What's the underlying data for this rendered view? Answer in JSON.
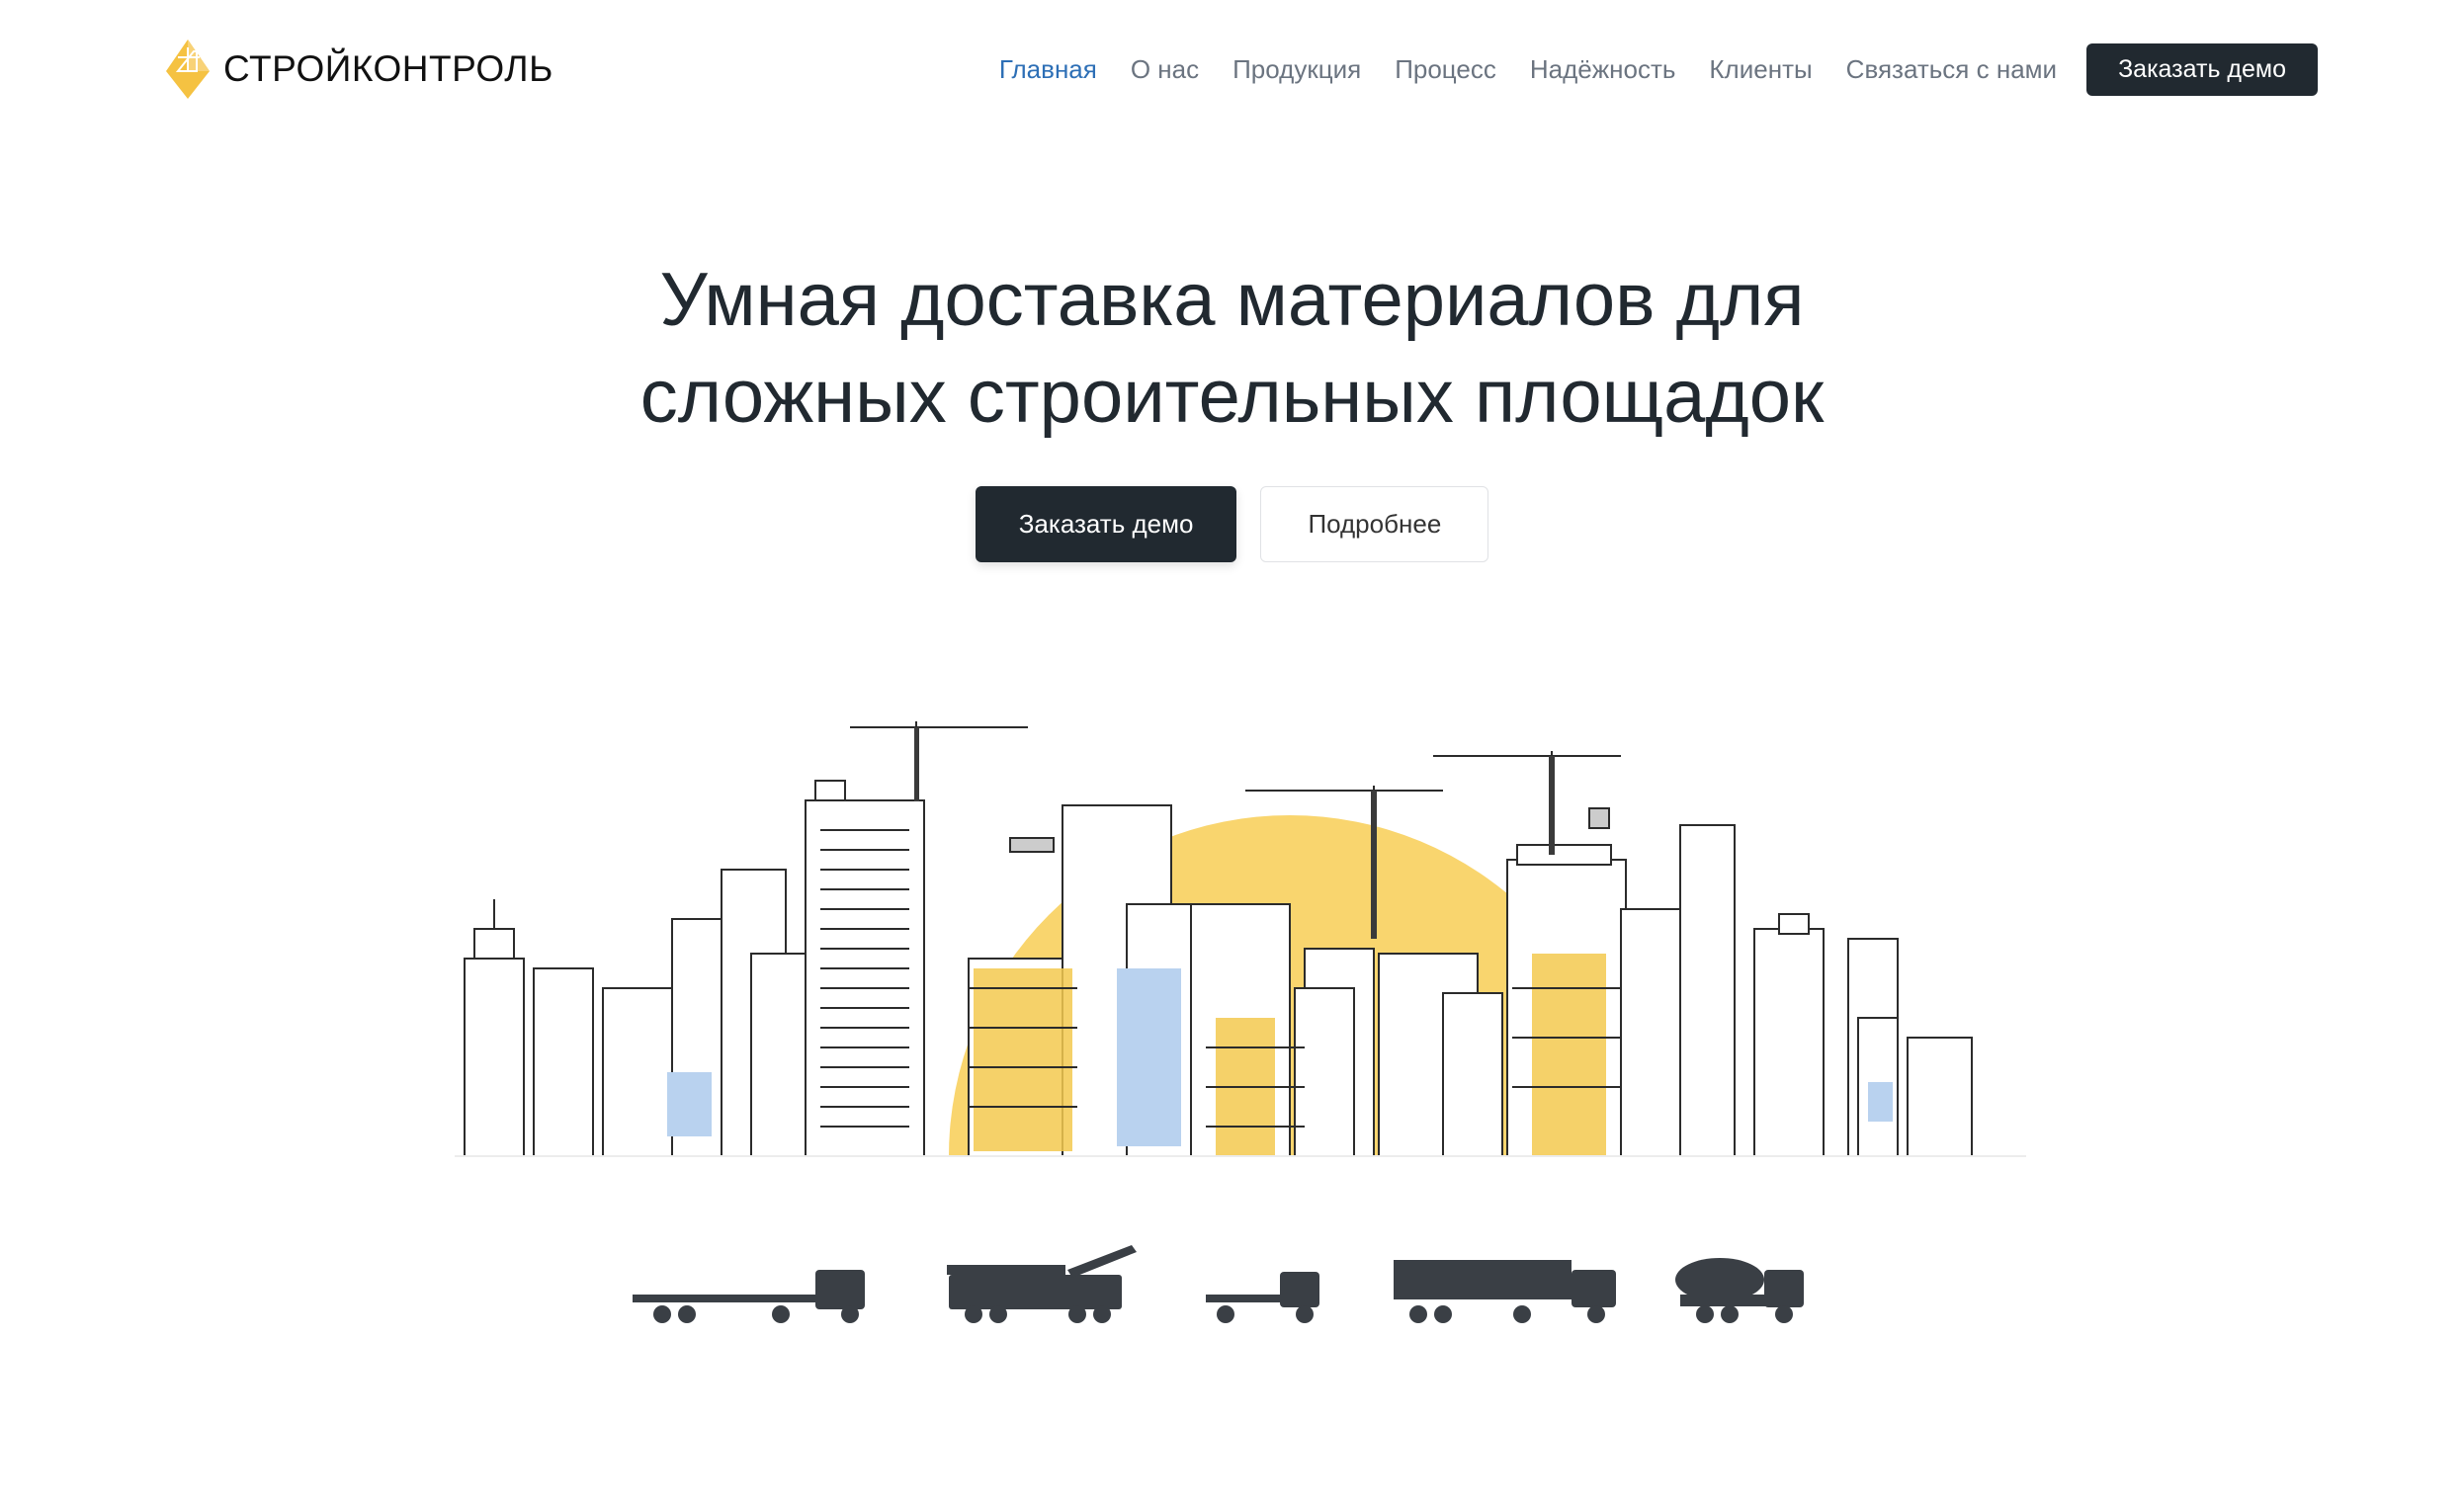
{
  "brand": {
    "name": "СТРОЙКОНТРОЛЬ",
    "logo_icon": "crane-diamond-icon",
    "accent": "#f5c242"
  },
  "nav": {
    "items": [
      {
        "label": "Главная",
        "active": true
      },
      {
        "label": "О нас"
      },
      {
        "label": "Продукция"
      },
      {
        "label": "Процесс"
      },
      {
        "label": "Надёжность"
      },
      {
        "label": "Клиенты"
      },
      {
        "label": "Связаться с нами"
      }
    ],
    "cta_label": "Заказать демо"
  },
  "hero": {
    "title_line1": "Умная доставка материалов для",
    "title_line2": "сложных строительных площадок",
    "primary_label": "Заказать демо",
    "secondary_label": "Подробнее"
  },
  "illustration": {
    "scene": "city-skyline-with-cranes",
    "sun_color": "#f9d56e",
    "window_accent": "#b9d2ef",
    "vehicles": [
      "flatbed-trailer-truck",
      "mobile-crane-truck",
      "small-flatbed-truck",
      "container-trailer-truck",
      "concrete-mixer-truck"
    ]
  },
  "colors": {
    "dark": "#212930",
    "link_active": "#2d6fb6",
    "link": "#6b7480"
  }
}
